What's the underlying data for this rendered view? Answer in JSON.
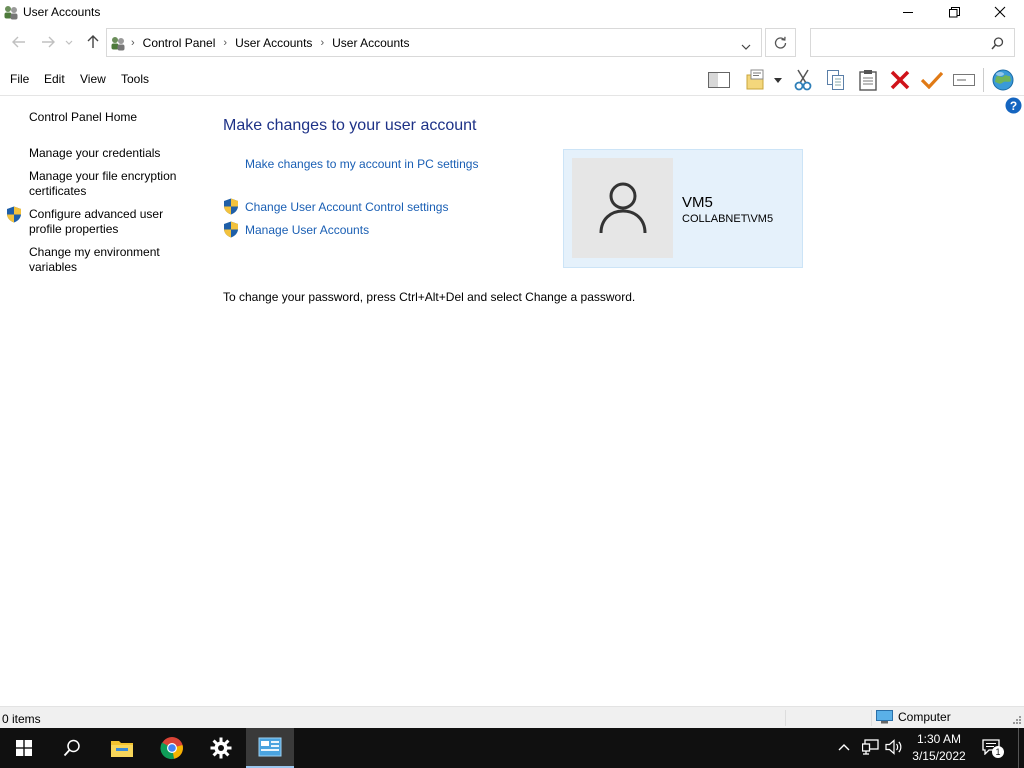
{
  "window": {
    "title": "User Accounts"
  },
  "address": {
    "crumbs": [
      "Control Panel",
      "User Accounts",
      "User Accounts"
    ],
    "search_placeholder": ""
  },
  "menu": {
    "file": "File",
    "edit": "Edit",
    "view": "View",
    "tools": "Tools"
  },
  "toolbar": {
    "icons": [
      "layout-pane-icon",
      "folder-options-icon",
      "cut-icon",
      "copy-icon",
      "paste-icon",
      "delete-icon",
      "properties-check-icon",
      "rename-icon",
      "globe-icon",
      "help-icon"
    ]
  },
  "left_nav": {
    "home": "Control Panel Home",
    "credentials": "Manage your credentials",
    "encryption": "Manage your file encryption certificates",
    "advanced_profile": "Configure advanced user profile properties",
    "environment": "Change my environment variables"
  },
  "main": {
    "heading": "Make changes to your user account",
    "pc_settings_link": "Make changes to my account in PC settings",
    "uac_link": "Change User Account Control settings",
    "manage_accounts_link": "Manage User Accounts",
    "password_text": "To change your password, press Ctrl+Alt+Del and select Change a password."
  },
  "user": {
    "name": "VM5",
    "domain": "COLLABNET\\VM5"
  },
  "statusbar": {
    "items": "0 items",
    "location": "Computer"
  },
  "taskbar": {
    "time": "1:30 AM",
    "date": "3/15/2022",
    "notification_count": "1"
  },
  "colors": {
    "heading": "#1e3287",
    "link": "#1a5fb4",
    "card_bg": "#e5f1fb",
    "taskbar_bg": "#101010"
  }
}
